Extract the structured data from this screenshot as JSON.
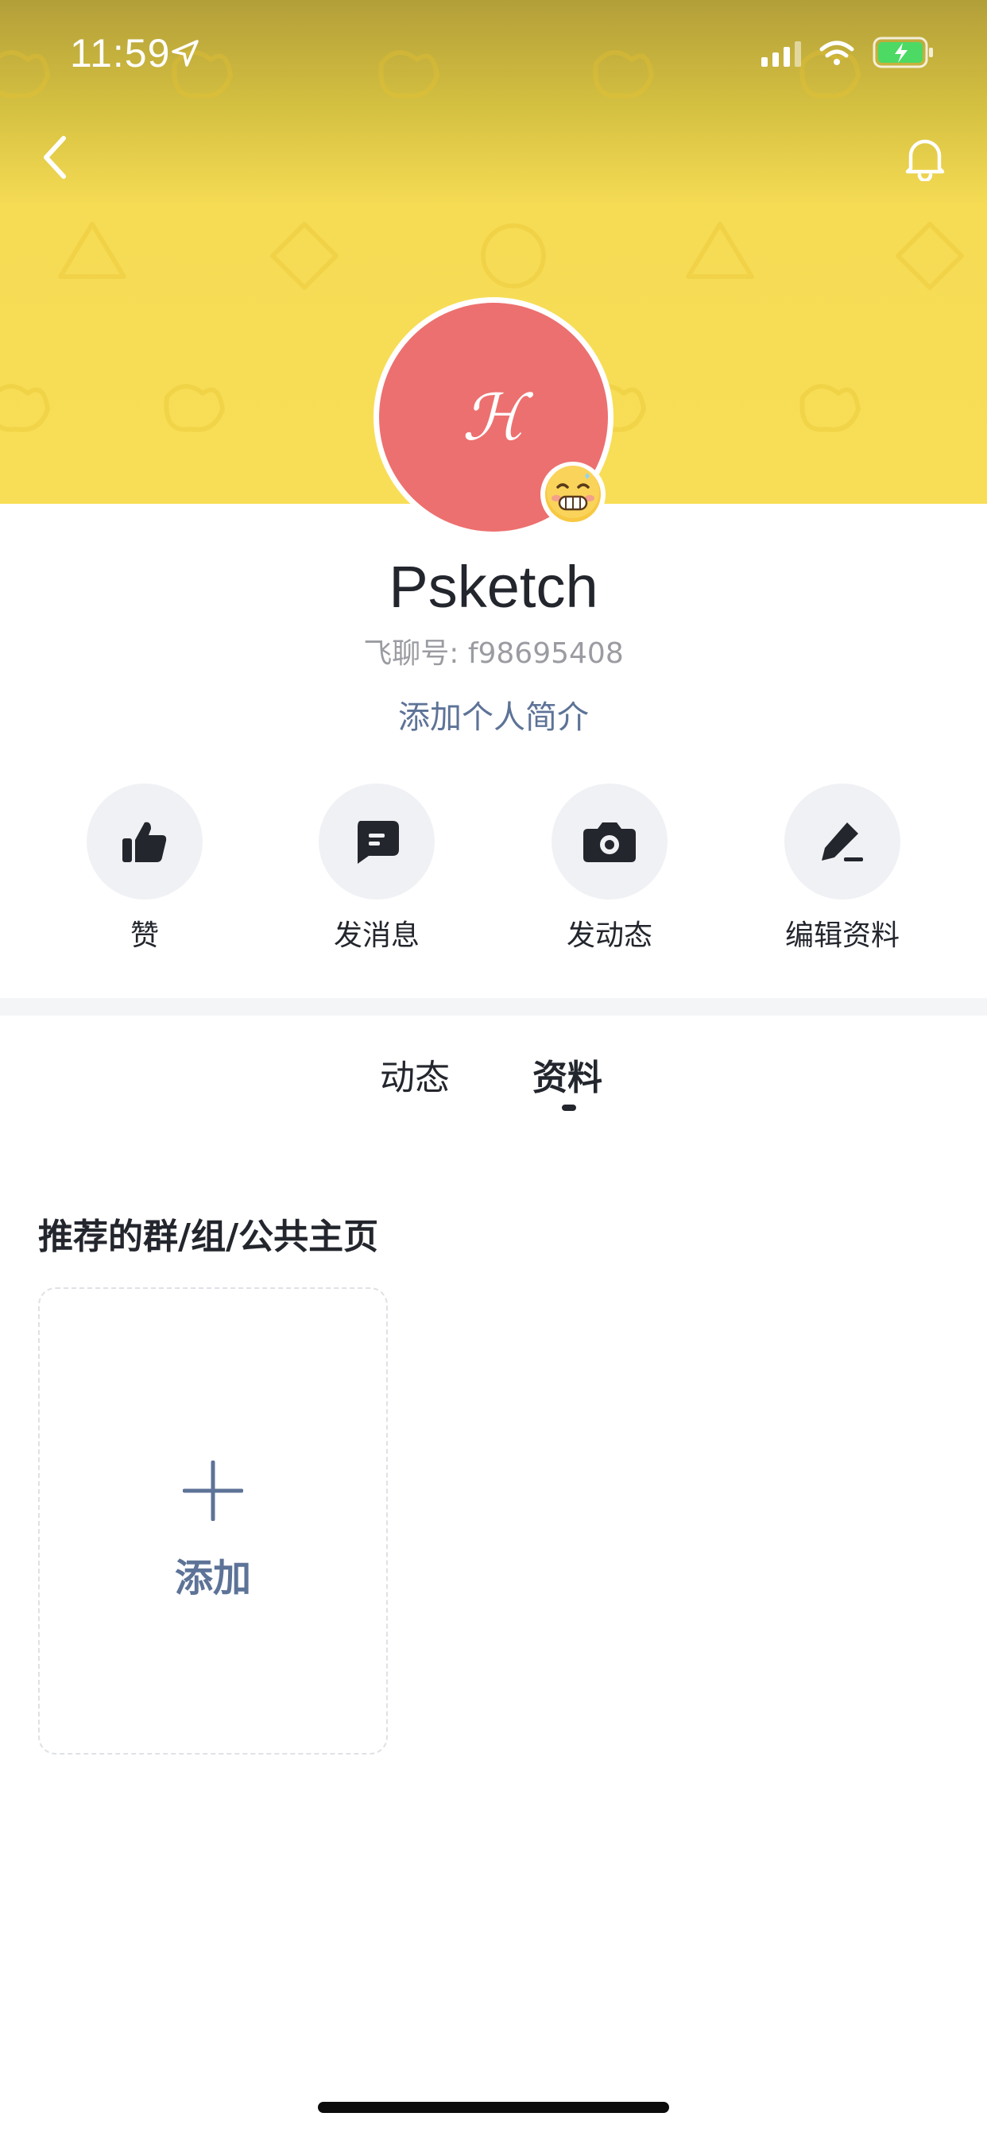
{
  "status_bar": {
    "time": "11:59"
  },
  "profile": {
    "name": "Psketch",
    "account_id": "飞聊号: f98695408",
    "bio_prompt": "添加个人简介",
    "avatar_glyph": "ℋ",
    "avatar_color": "#ec706f",
    "header_color": "#f6dc55"
  },
  "actions": [
    {
      "label": "赞",
      "icon": "thumbs-up-icon"
    },
    {
      "label": "发消息",
      "icon": "message-icon"
    },
    {
      "label": "发动态",
      "icon": "camera-icon"
    },
    {
      "label": "编辑资料",
      "icon": "edit-icon"
    }
  ],
  "tabs": [
    {
      "label": "动态",
      "active": false
    },
    {
      "label": "资料",
      "active": true
    }
  ],
  "recommended": {
    "title": "推荐的群/组/公共主页",
    "add_label": "添加"
  },
  "colors": {
    "accent_blue": "#5d7397",
    "text_dark": "#23262d",
    "text_gray": "#9a9ca1"
  }
}
